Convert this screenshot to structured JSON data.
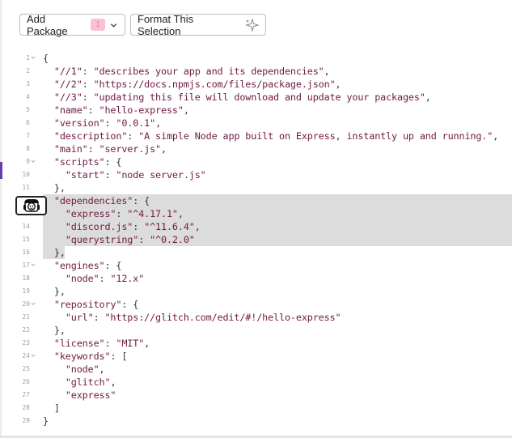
{
  "toolbar": {
    "add_package_label": "Add Package",
    "add_package_badge": "1",
    "format_label": "Format This Selection"
  },
  "editor": {
    "lines": [
      {
        "n": "1",
        "fold": true,
        "tokens": [
          [
            "p",
            "{"
          ]
        ]
      },
      {
        "n": "2",
        "tokens": [
          [
            "p",
            "  "
          ],
          [
            "k",
            "\"//1\""
          ],
          [
            "p",
            ": "
          ],
          [
            "s",
            "\"describes your app and its dependencies\""
          ],
          [
            "p",
            ","
          ]
        ]
      },
      {
        "n": "3",
        "tokens": [
          [
            "p",
            "  "
          ],
          [
            "k",
            "\"//2\""
          ],
          [
            "p",
            ": "
          ],
          [
            "s",
            "\"https://docs.npmjs.com/files/package.json\""
          ],
          [
            "p",
            ","
          ]
        ]
      },
      {
        "n": "4",
        "tokens": [
          [
            "p",
            "  "
          ],
          [
            "k",
            "\"//3\""
          ],
          [
            "p",
            ": "
          ],
          [
            "s",
            "\"updating this file will download and update your packages\""
          ],
          [
            "p",
            ","
          ]
        ]
      },
      {
        "n": "5",
        "tokens": [
          [
            "p",
            "  "
          ],
          [
            "k",
            "\"name\""
          ],
          [
            "p",
            ": "
          ],
          [
            "s",
            "\"hello-express\""
          ],
          [
            "p",
            ","
          ]
        ]
      },
      {
        "n": "6",
        "tokens": [
          [
            "p",
            "  "
          ],
          [
            "k",
            "\"version\""
          ],
          [
            "p",
            ": "
          ],
          [
            "s",
            "\"0.0.1\""
          ],
          [
            "p",
            ","
          ]
        ]
      },
      {
        "n": "7",
        "tokens": [
          [
            "p",
            "  "
          ],
          [
            "k",
            "\"description\""
          ],
          [
            "p",
            ": "
          ],
          [
            "s",
            "\"A simple Node app built on Express, instantly up and running.\""
          ],
          [
            "p",
            ","
          ]
        ]
      },
      {
        "n": "8",
        "tokens": [
          [
            "p",
            "  "
          ],
          [
            "k",
            "\"main\""
          ],
          [
            "p",
            ": "
          ],
          [
            "s",
            "\"server.js\""
          ],
          [
            "p",
            ","
          ]
        ]
      },
      {
        "n": "9",
        "fold": true,
        "tokens": [
          [
            "p",
            "  "
          ],
          [
            "k",
            "\"scripts\""
          ],
          [
            "p",
            ": {"
          ]
        ]
      },
      {
        "n": "10",
        "tokens": [
          [
            "p",
            "    "
          ],
          [
            "k",
            "\"start\""
          ],
          [
            "p",
            ": "
          ],
          [
            "s",
            "\"node server.js\""
          ]
        ]
      },
      {
        "n": "11",
        "tokens": [
          [
            "p",
            "  },"
          ]
        ]
      },
      {
        "n": "12",
        "hl": "full",
        "tokens": [
          [
            "p",
            "  "
          ],
          [
            "k",
            "\"dependencies\""
          ],
          [
            "p",
            ": {"
          ]
        ]
      },
      {
        "n": "13",
        "hl": "full",
        "tokens": [
          [
            "p",
            "    "
          ],
          [
            "k",
            "\"express\""
          ],
          [
            "p",
            ": "
          ],
          [
            "s",
            "\"^4.17.1\""
          ],
          [
            "p",
            ","
          ]
        ]
      },
      {
        "n": "14",
        "hl": "full",
        "tokens": [
          [
            "p",
            "    "
          ],
          [
            "k",
            "\"discord.js\""
          ],
          [
            "p",
            ": "
          ],
          [
            "s",
            "\"^11.6.4\""
          ],
          [
            "p",
            ","
          ]
        ]
      },
      {
        "n": "15",
        "hl": "full",
        "tokens": [
          [
            "p",
            "    "
          ],
          [
            "k",
            "\"querystring\""
          ],
          [
            "p",
            ": "
          ],
          [
            "s",
            "\"^0.2.0\""
          ]
        ]
      },
      {
        "n": "16",
        "hl": "part",
        "tokens": [
          [
            "p",
            "  },"
          ]
        ]
      },
      {
        "n": "17",
        "fold": true,
        "tokens": [
          [
            "p",
            "  "
          ],
          [
            "k",
            "\"engines\""
          ],
          [
            "p",
            ": {"
          ]
        ]
      },
      {
        "n": "18",
        "tokens": [
          [
            "p",
            "    "
          ],
          [
            "k",
            "\"node\""
          ],
          [
            "p",
            ": "
          ],
          [
            "s",
            "\"12.x\""
          ]
        ]
      },
      {
        "n": "19",
        "tokens": [
          [
            "p",
            "  },"
          ]
        ]
      },
      {
        "n": "20",
        "fold": true,
        "tokens": [
          [
            "p",
            "  "
          ],
          [
            "k",
            "\"repository\""
          ],
          [
            "p",
            ": {"
          ]
        ]
      },
      {
        "n": "21",
        "tokens": [
          [
            "p",
            "    "
          ],
          [
            "k",
            "\"url\""
          ],
          [
            "p",
            ": "
          ],
          [
            "s",
            "\"https://glitch.com/edit/#!/hello-express\""
          ]
        ]
      },
      {
        "n": "22",
        "tokens": [
          [
            "p",
            "  },"
          ]
        ]
      },
      {
        "n": "23",
        "tokens": [
          [
            "p",
            "  "
          ],
          [
            "k",
            "\"license\""
          ],
          [
            "p",
            ": "
          ],
          [
            "s",
            "\"MIT\""
          ],
          [
            "p",
            ","
          ]
        ]
      },
      {
        "n": "24",
        "fold": true,
        "tokens": [
          [
            "p",
            "  "
          ],
          [
            "k",
            "\"keywords\""
          ],
          [
            "p",
            ": ["
          ]
        ]
      },
      {
        "n": "25",
        "tokens": [
          [
            "p",
            "    "
          ],
          [
            "s",
            "\"node\""
          ],
          [
            "p",
            ","
          ]
        ]
      },
      {
        "n": "26",
        "tokens": [
          [
            "p",
            "    "
          ],
          [
            "s",
            "\"glitch\""
          ],
          [
            "p",
            ","
          ]
        ]
      },
      {
        "n": "27",
        "tokens": [
          [
            "p",
            "    "
          ],
          [
            "s",
            "\"express\""
          ]
        ]
      },
      {
        "n": "28",
        "tokens": [
          [
            "p",
            "  ]"
          ]
        ]
      },
      {
        "n": "29",
        "tokens": [
          [
            "p",
            "}"
          ]
        ]
      }
    ]
  },
  "icons": {
    "chevron": "chevron-down-icon",
    "sparkle": "sparkle-icon",
    "avatar": "glitch-avatar-icon",
    "fold": "fold-arrow-icon"
  },
  "colors": {
    "json_key_string": "#6e1a43",
    "selection": "#dcdcdc",
    "badge_bg": "#f7c1d2",
    "accent_bar": "#6a3ea8"
  }
}
